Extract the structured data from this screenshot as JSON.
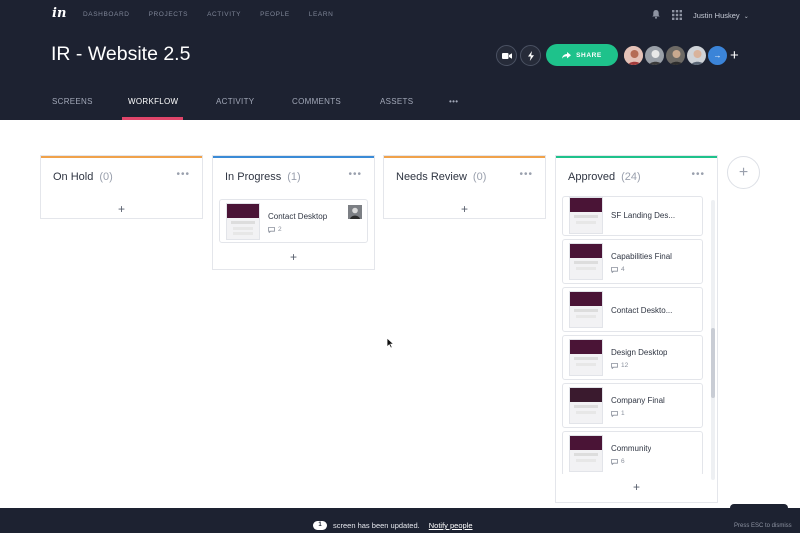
{
  "app": {
    "logo": "in"
  },
  "topnav": [
    "DASHBOARD",
    "PROJECTS",
    "ACTIVITY",
    "PEOPLE",
    "LEARN"
  ],
  "user": {
    "name": "Justin Huskey",
    "caret": "⌄"
  },
  "project": {
    "title": "IR - Website 2.5"
  },
  "share_label": "SHARE",
  "avatars_more": "→",
  "add_column_header": "+",
  "subnav": [
    "SCREENS",
    "WORKFLOW",
    "ACTIVITY",
    "COMMENTS",
    "ASSETS",
    "•••"
  ],
  "columns": [
    {
      "name": "On Hold",
      "count": "(0)",
      "color": "#f0a24b",
      "cards": [],
      "add": "+"
    },
    {
      "name": "In Progress",
      "count": "(1)",
      "color": "#3b8bd6",
      "add": "+",
      "cards": [
        {
          "name": "Contact Desktop",
          "comments": "2"
        }
      ]
    },
    {
      "name": "Needs Review",
      "count": "(0)",
      "color": "#f0a24b",
      "cards": [],
      "add": "+"
    },
    {
      "name": "Approved",
      "count": "(24)",
      "color": "#1ec28b",
      "add": "+",
      "cards": [
        {
          "name": "SF Landing Des...",
          "comments": ""
        },
        {
          "name": "Capabilities Final",
          "comments": "4"
        },
        {
          "name": "Contact Deskto...",
          "comments": ""
        },
        {
          "name": "Design Desktop",
          "comments": "12"
        },
        {
          "name": "Company Final",
          "comments": "1"
        },
        {
          "name": "Community",
          "comments": "6"
        }
      ]
    }
  ],
  "column_menu": "•••",
  "add_column": "+",
  "footer": {
    "count": "1",
    "message": "screen has been updated.",
    "action": "Notify people",
    "esc": "Press ESC to dismiss"
  },
  "colors": {
    "header_bg": "#1d2231",
    "accent_pink": "#e0456a",
    "share_green": "#1ec28b"
  }
}
